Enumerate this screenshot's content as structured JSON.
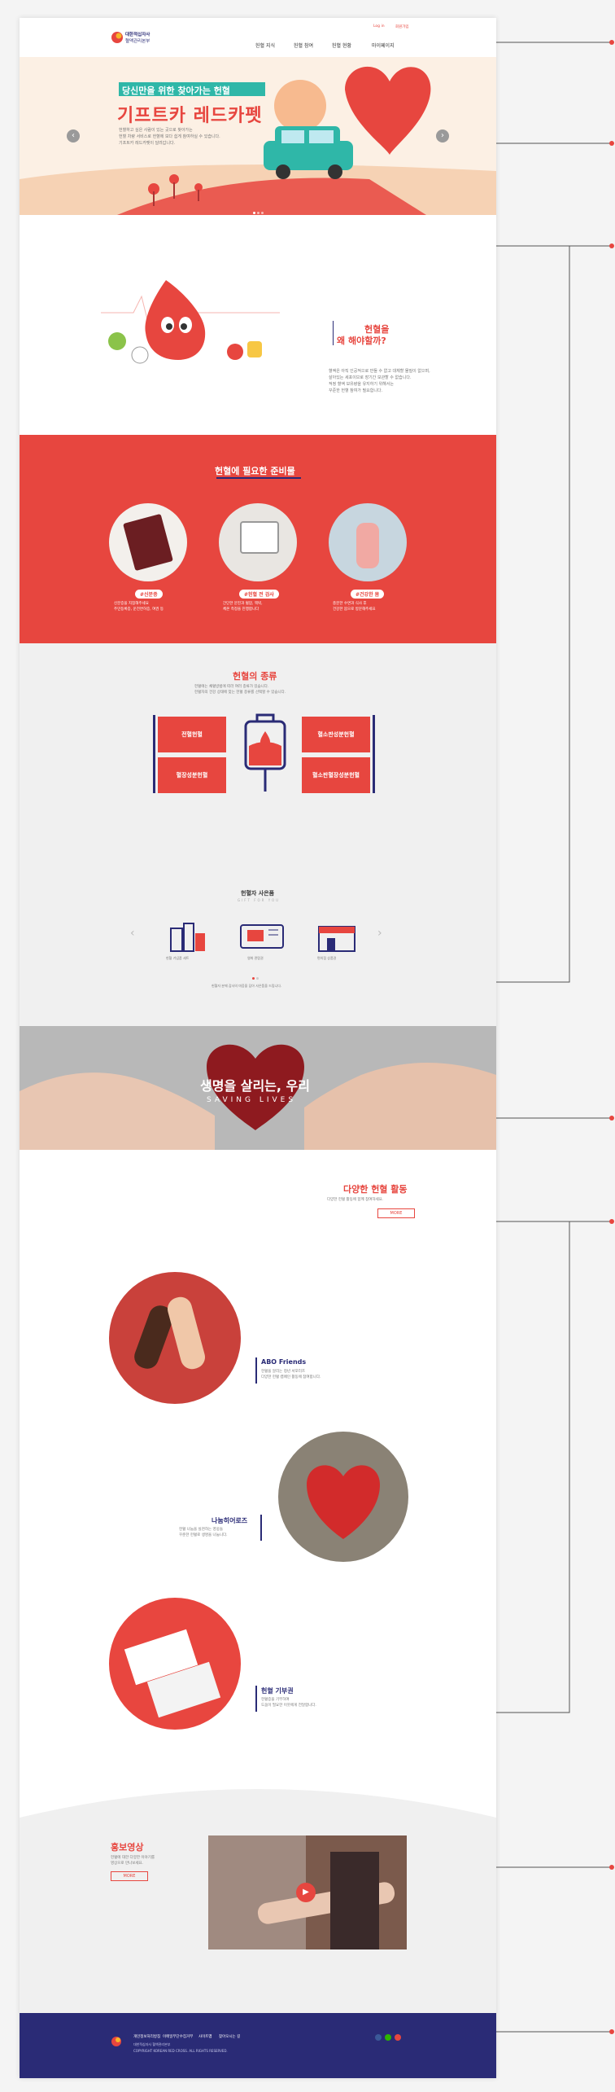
{
  "header": {
    "logo_line1": "대한적십자사",
    "logo_line2": "혈액관리본부",
    "top_links": [
      "Log in",
      "회원가입"
    ],
    "nav": [
      "헌혈 지식",
      "헌혈 참여",
      "헌혈 현황",
      "마이페이지"
    ]
  },
  "hero": {
    "badge": "당신만을 위한 찾아가는 헌혈",
    "title": "기프트카 레드카펫",
    "desc": [
      "헌혈하고 싶은 사람이 있는 곳으로 찾아가는",
      "헌혈 차량 서비스로 헌혈에 보다 쉽게 참여하실 수 있습니다.",
      "기프트카 레드카펫이 달려갑니다."
    ]
  },
  "why": {
    "title_line1": "헌혈을",
    "title_line2": "왜 해야할까?",
    "desc": [
      "혈액은 아직 인공적으로 만들 수 없고 대체할 물질이 없으며,",
      "살아있는 세포이므로 장기간 보관할 수 없습니다.",
      "적정 혈액 보유량을 유지하기 위해서는",
      "꾸준한 헌혈 참여가 필요합니다."
    ]
  },
  "prep": {
    "title": "헌혈에 필요한 준비물",
    "items": [
      {
        "label": "#신분증",
        "desc": [
          "신분증을 지참해주세요",
          "주민등록증, 운전면허증, 여권 등"
        ]
      },
      {
        "label": "#헌혈 전 검사",
        "desc": [
          "간단한 문진과 혈압, 맥박,",
          "체온 측정을 진행합니다"
        ]
      },
      {
        "label": "#건강한 몸",
        "desc": [
          "충분한 수면과 식사 후",
          "건강한 몸으로 방문해주세요"
        ]
      }
    ]
  },
  "types": {
    "title": "헌혈의 종류",
    "desc": [
      "헌혈에는 채혈방법에 따라 여러 종류가 있습니다.",
      "헌혈자의 건강 상태에 맞는 헌혈 종류를 선택할 수 있습니다."
    ],
    "left": [
      "전혈헌혈",
      "혈장성분헌혈"
    ],
    "right": [
      "혈소판성분헌혈",
      "혈소판혈장성분헌혈"
    ]
  },
  "gifts": {
    "title": "헌혈자 사은품",
    "subtitle": "GIFT FOR YOU",
    "items": [
      "헌혈 기념품 세트",
      "영화 관람권",
      "편의점 상품권"
    ],
    "note": "헌혈자 분께 감사의 마음을 담아 사은품을 드립니다."
  },
  "banner": {
    "title": "생명을 살리는, 우리",
    "subtitle": "SAVING LIVES"
  },
  "activities": {
    "title": "다양한 헌혈 활동",
    "desc": "다양한 헌혈 활동에 함께 참여하세요.",
    "more": "MORE",
    "items": [
      {
        "name": "ABO Friends",
        "desc": [
          "헌혈을 알리는 청년 서포터즈",
          "다양한 헌혈 캠페인 활동에 참여합니다."
        ]
      },
      {
        "name": "나눔히어로즈",
        "desc": [
          "헌혈 나눔을 실천하는 영웅들",
          "꾸준한 헌혈로 생명을 나눕니다."
        ]
      },
      {
        "name": "헌혈 기부권",
        "desc": [
          "헌혈증을 기부하여",
          "도움이 필요한 이웃에게 전달합니다."
        ]
      }
    ]
  },
  "promo": {
    "title": "홍보영상",
    "desc": [
      "헌혈에 대한 다양한 이야기를",
      "영상으로 만나보세요."
    ],
    "more": "MORE"
  },
  "footer": {
    "links": [
      "개인정보처리방침",
      "이메일무단수집거부",
      "사이트맵",
      "찾아오시는 길"
    ],
    "address": "대한적십자사 혈액관리본부",
    "copyright": "COPYRIGHT KOREAN RED CROSS. ALL RIGHTS RESERVED."
  },
  "colors": {
    "accent": "#e7463f",
    "navy": "#2a2b76",
    "mint": "#2fb7a8"
  }
}
